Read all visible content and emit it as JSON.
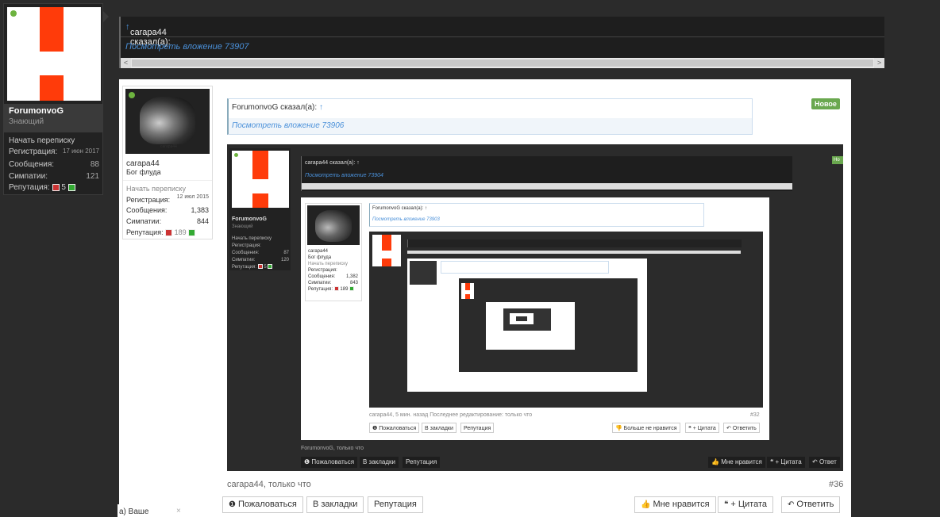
{
  "outer_user": {
    "name": "ForumonvoG",
    "title": "Знающий",
    "start_conversation": "Начать переписку",
    "registration_label": "Регистрация:",
    "registration_value": "17 июн 2017",
    "messages_label": "Сообщения:",
    "messages_value": "88",
    "likes_label": "Симпатии:",
    "likes_value": "121",
    "reputation_label": "Репутация:",
    "reputation_value": "5",
    "online_color": "#6db33f"
  },
  "top_quote": {
    "author": "carapa44 сказал(а):",
    "arrow": "↑",
    "attachment_link": "Посмотреть вложение 73907"
  },
  "post": {
    "user": {
      "name": "carapa44",
      "title": "Бог флуда",
      "start_conversation": "Начать переписку",
      "registration_label": "Регистрация:",
      "registration_value": "12 июл 2015",
      "messages_label": "Сообщения:",
      "messages_value": "1,383",
      "likes_label": "Симпатии:",
      "likes_value": "844",
      "reputation_label": "Репутация:",
      "reputation_value": "189",
      "avatar_caption": "carapa44"
    },
    "quote": {
      "author": "ForumonvoG сказал(а):",
      "arrow": "↑",
      "attachment_link": "Посмотреть вложение 73906"
    },
    "new_badge": "Новое",
    "footer_meta": "carapa44, только что",
    "post_number": "#36",
    "buttons": {
      "report": "Пожаловаться",
      "bookmark": "В закладки",
      "reputation": "Репутация",
      "like": "Мне нравится",
      "quote": "+ Цитата",
      "reply": "Ответить"
    }
  },
  "embedded": {
    "lv1_user": {
      "name": "ForumonvoG",
      "title": "Знающий",
      "start_conversation": "Начать переписку",
      "registration": "Регистрация:",
      "messages": "Сообщения:",
      "messages_value": "87",
      "likes": "Симпатии:",
      "likes_value": "120",
      "reputation": "Репутация:",
      "reputation_value": "5"
    },
    "lv1_quote_author": "carapa44 сказал(а): ↑",
    "lv1_quote_link": "Посмотреть вложение 73904",
    "lv1_badge": "Но",
    "lv2_user": {
      "name": "carapa44",
      "title": "Бог флуда",
      "start_conversation": "Начать переписку",
      "registration": "Регистрация:",
      "messages": "Сообщения:",
      "messages_value": "1,382",
      "likes": "Симпатии:",
      "likes_value": "843",
      "reputation": "Репутация:",
      "reputation_value": "189"
    },
    "lv2_quote_author": "ForumonvoG сказал(а): ↑",
    "lv2_quote_link": "Посмотреть вложение 73903",
    "lv2_footer": "carapa44, 5 мин. назад  Последнее редактирование: только что",
    "lv2_number": "#32",
    "lv2_buttons": {
      "report": "Пожаловаться",
      "bookmark": "В закладки",
      "reputation": "Репутация",
      "unlike": "Больше не нравится",
      "quote": "+ Цитата",
      "reply": "Ответить"
    },
    "lv1_footer": "ForumonvoG, только что",
    "lv1_buttons": {
      "report": "Пожаловаться",
      "bookmark": "В закладки",
      "reputation": "Репутация",
      "like": "Мне нравится",
      "quote": "+ Цитата",
      "reply": "Ответ"
    }
  },
  "popup": {
    "text": "а) Ваше",
    "close": "×"
  },
  "colors": {
    "background": "#2b2b2b",
    "accent_red": "#ff3b0a",
    "link": "#4a90d9",
    "badge_green": "#6aa84f"
  }
}
